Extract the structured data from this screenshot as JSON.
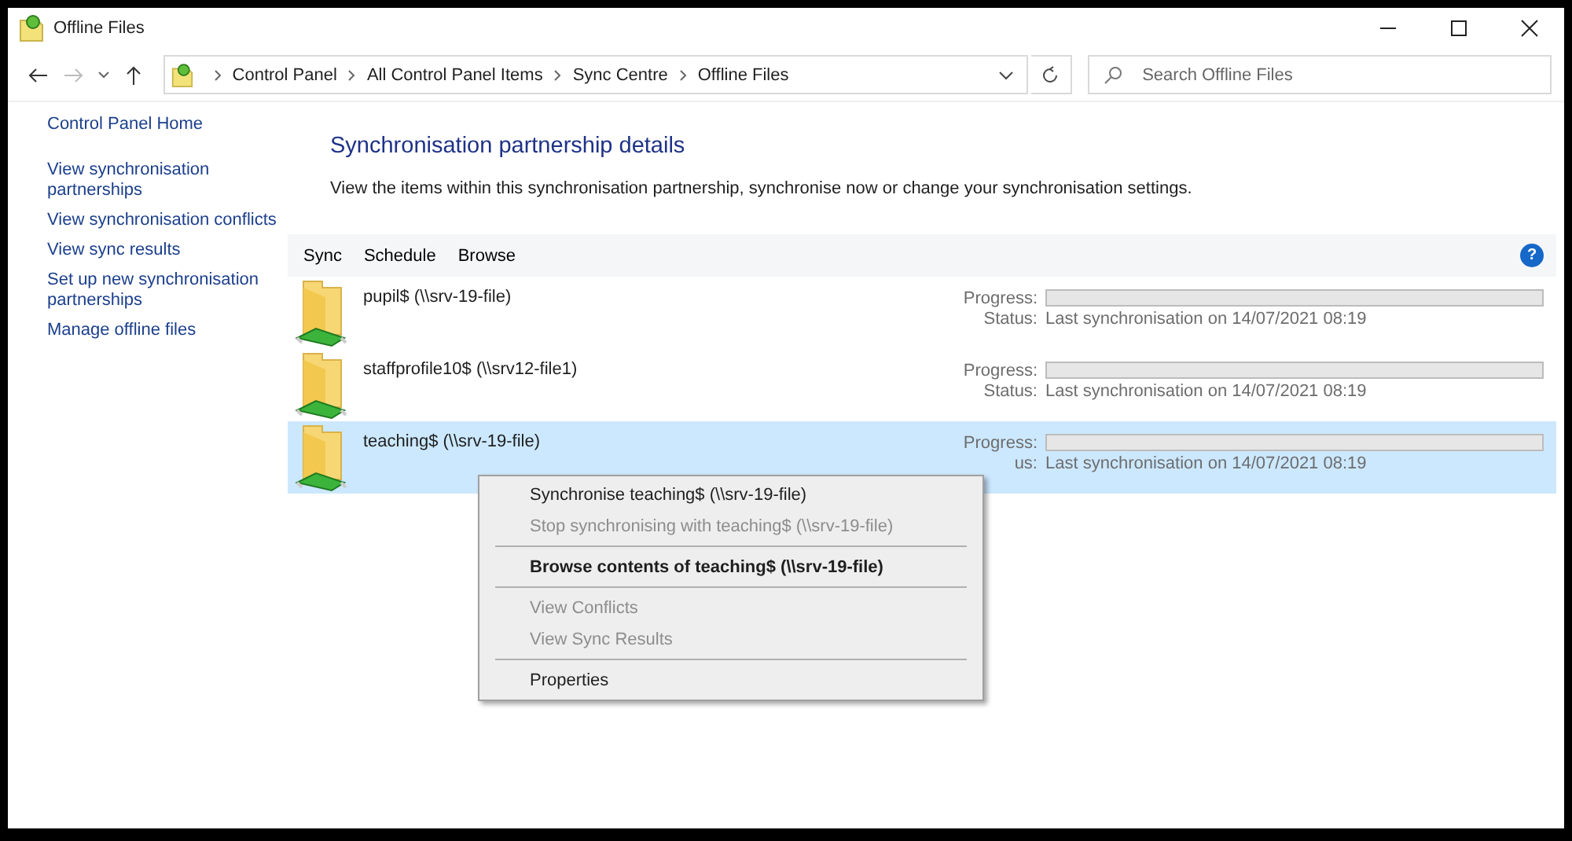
{
  "window": {
    "title": "Offline Files"
  },
  "address_bar": {
    "crumbs": [
      "Control Panel",
      "All Control Panel Items",
      "Sync Centre",
      "Offline Files"
    ]
  },
  "search": {
    "placeholder": "Search Offline Files"
  },
  "sidebar": {
    "items": [
      {
        "label": "Control Panel Home"
      },
      {
        "label": "View synchronisation partnerships"
      },
      {
        "label": "View synchronisation conflicts"
      },
      {
        "label": "View sync results"
      },
      {
        "label": "Set up new synchronisation partnerships"
      },
      {
        "label": "Manage offline files"
      }
    ]
  },
  "heading": "Synchronisation partnership details",
  "description": "View the items within this synchronisation partnership, synchronise now or change your synchronisation settings.",
  "toolbar": {
    "buttons": [
      "Sync",
      "Schedule",
      "Browse"
    ],
    "help": "?"
  },
  "items": [
    {
      "name": "pupil$ (\\\\srv-19-file)",
      "selected": false,
      "progress_label": "Progress:",
      "level": 0,
      "status_label": "Status:",
      "status": "Last synchronisation on 14/07/2021 08:19"
    },
    {
      "name": "staffprofile10$ (\\\\srv12-file1)",
      "selected": false,
      "progress_label": "Progress:",
      "level": 0,
      "status_label": "Status:",
      "status": "Last synchronisation on 14/07/2021 08:19"
    },
    {
      "name": "teaching$ (\\\\srv-19-file)",
      "selected": true,
      "progress_label": "Progress:",
      "level": 0,
      "status_label": "us:",
      "status": "Last synchronisation on 14/07/2021 08:19"
    }
  ],
  "context_menu": {
    "items": [
      {
        "kind": "item",
        "label": "Synchronise teaching$ (\\\\srv-19-file)",
        "disabled": false,
        "bold": false
      },
      {
        "kind": "item",
        "label": "Stop synchronising with teaching$ (\\\\srv-19-file)",
        "disabled": true,
        "bold": false
      },
      {
        "kind": "separator"
      },
      {
        "kind": "item",
        "label": "Browse contents of teaching$ (\\\\srv-19-file)",
        "disabled": false,
        "bold": true
      },
      {
        "kind": "separator"
      },
      {
        "kind": "item",
        "label": "View Conflicts",
        "disabled": true,
        "bold": false
      },
      {
        "kind": "item",
        "label": "View Sync Results",
        "disabled": true,
        "bold": false
      },
      {
        "kind": "separator"
      },
      {
        "kind": "item",
        "label": "Properties",
        "disabled": false,
        "bold": false
      }
    ]
  }
}
